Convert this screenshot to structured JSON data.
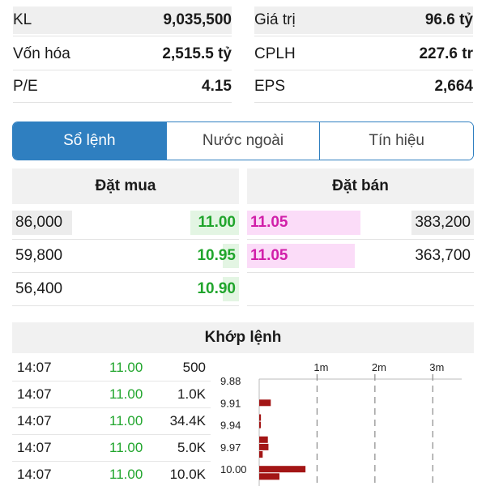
{
  "stats": {
    "left": [
      {
        "label": "KL",
        "value": "9,035,500"
      },
      {
        "label": "Vốn hóa",
        "value": "2,515.5 tỷ"
      },
      {
        "label": "P/E",
        "value": "4.15"
      }
    ],
    "right": [
      {
        "label": "Giá trị",
        "value": "96.6 tỷ"
      },
      {
        "label": "CPLH",
        "value": "227.6 tr"
      },
      {
        "label": "EPS",
        "value": "2,664"
      }
    ]
  },
  "tabs": [
    {
      "label": "Sổ lệnh",
      "active": true
    },
    {
      "label": "Nước ngoài",
      "active": false
    },
    {
      "label": "Tín hiệu",
      "active": false
    }
  ],
  "order_book": {
    "buy_title": "Đặt mua",
    "sell_title": "Đặt bán",
    "buy": [
      {
        "volume": "86,000",
        "price": "11.00"
      },
      {
        "volume": "59,800",
        "price": "10.95"
      },
      {
        "volume": "56,400",
        "price": "10.90"
      }
    ],
    "sell": [
      {
        "price": "11.05",
        "volume": "383,200"
      },
      {
        "price": "11.05",
        "volume": "363,700"
      }
    ]
  },
  "match": {
    "title": "Khớp lệnh",
    "trades": [
      {
        "time": "14:07",
        "price": "11.00",
        "volume": "500"
      },
      {
        "time": "14:07",
        "price": "11.00",
        "volume": "1.0K"
      },
      {
        "time": "14:07",
        "price": "11.00",
        "volume": "34.4K"
      },
      {
        "time": "14:07",
        "price": "11.00",
        "volume": "5.0K"
      },
      {
        "time": "14:07",
        "price": "11.00",
        "volume": "10.0K"
      }
    ]
  },
  "colors": {
    "accent": "#2f7fc0",
    "buy": "#20a52c",
    "sell": "#d11fa9",
    "bar": "#a31515"
  },
  "chart_data": {
    "type": "bar",
    "orientation": "horizontal",
    "x_ticks": [
      "1m",
      "2m",
      "3m"
    ],
    "x_tick_values": [
      1000000,
      2000000,
      3000000
    ],
    "xlim": [
      0,
      3500000
    ],
    "y_ticks": [
      "9.88",
      "9.91",
      "9.94",
      "9.97",
      "10.00"
    ],
    "categories": [
      9.88,
      9.89,
      9.9,
      9.91,
      9.92,
      9.93,
      9.94,
      9.95,
      9.96,
      9.97,
      9.98,
      9.99,
      10.0,
      10.01
    ],
    "values": [
      0,
      0,
      0,
      200000,
      0,
      30000,
      20000,
      0,
      150000,
      160000,
      60000,
      0,
      800000,
      350000
    ]
  }
}
